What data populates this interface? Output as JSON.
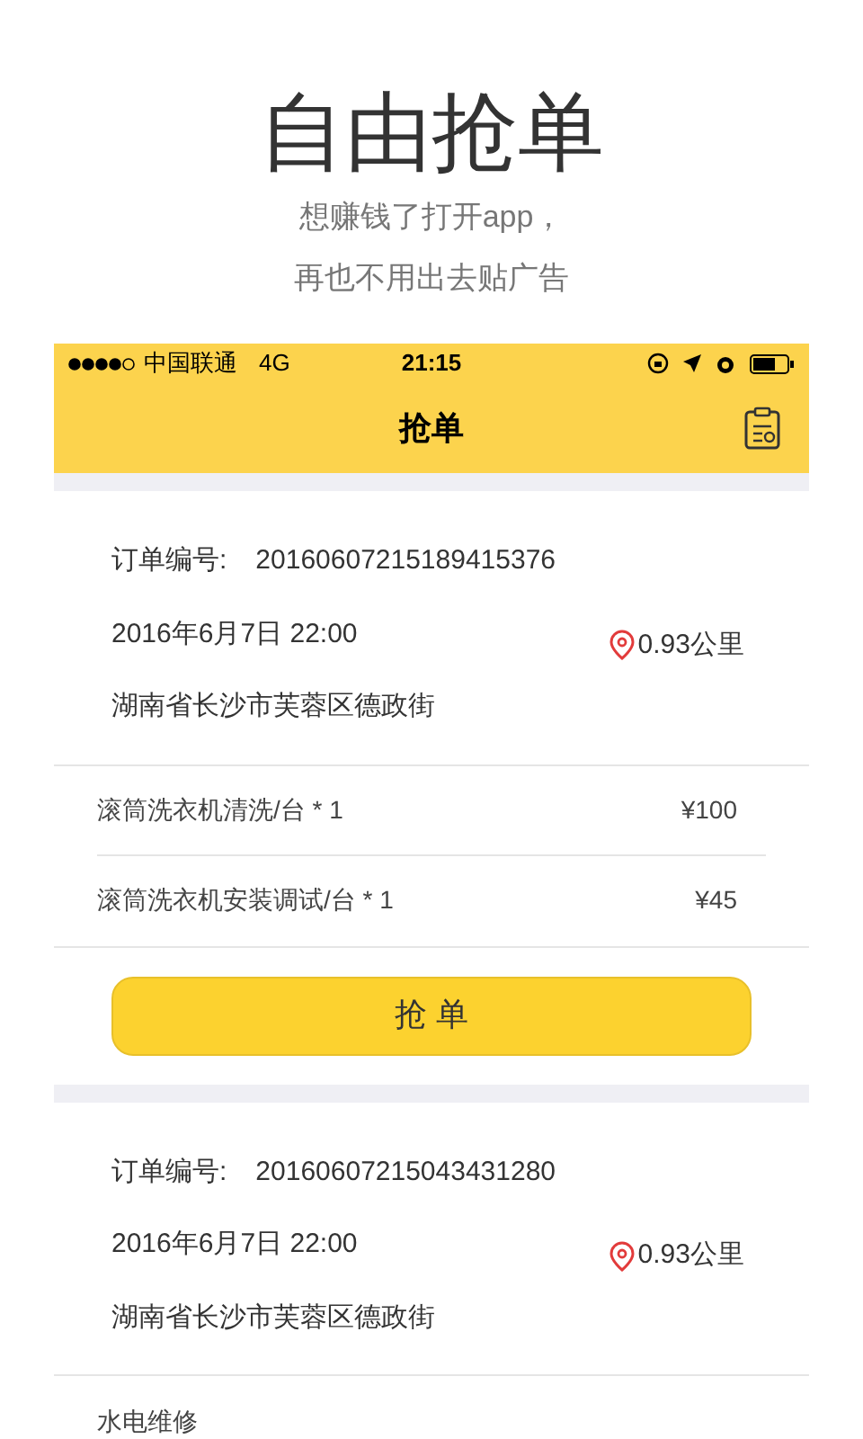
{
  "promo": {
    "headline": "自由抢单",
    "lines": [
      "想赚钱了打开app，",
      "再也不用出去贴广告"
    ]
  },
  "status_bar": {
    "carrier": "中国联通",
    "network": "4G",
    "time": "21:15"
  },
  "nav": {
    "title": "抢单"
  },
  "orders": [
    {
      "order_label": "订单编号:",
      "order_no": "20160607215189415376",
      "datetime": "2016年6月7日 22:00",
      "distance": "0.93公里",
      "address": "湖南省长沙市芙蓉区德政街",
      "items": [
        {
          "name": "滚筒洗衣机清洗/台 * 1",
          "price": "¥100"
        },
        {
          "name": "滚筒洗衣机安装调试/台 * 1",
          "price": "¥45"
        }
      ],
      "button": "抢 单"
    },
    {
      "order_label": "订单编号:",
      "order_no": "20160607215043431280",
      "datetime": "2016年6月7日 22:00",
      "distance": "0.93公里",
      "address": "湖南省长沙市芙蓉区德政街",
      "items": [
        {
          "name": "水电维修"
        }
      ]
    }
  ]
}
